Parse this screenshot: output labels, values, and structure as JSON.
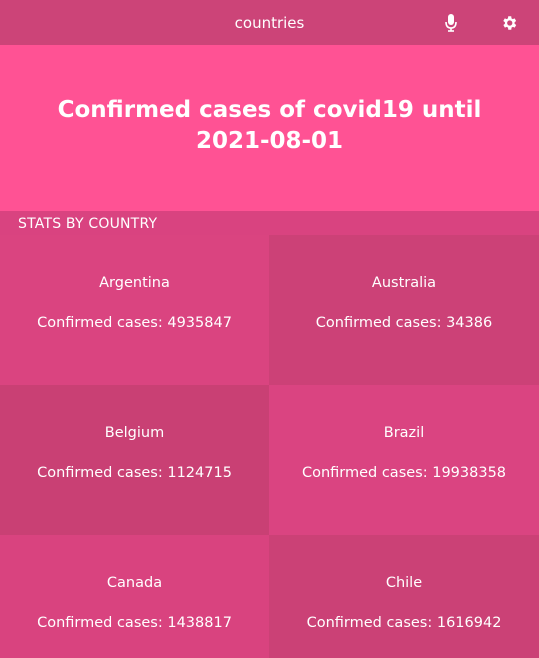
{
  "header": {
    "title": "countries",
    "icons": [
      "microphone-icon",
      "gear-icon"
    ]
  },
  "hero": {
    "title": "Confirmed cases of covid19 until 2021-08-01"
  },
  "section": {
    "label": "STATS BY COUNTRY"
  },
  "countries": [
    {
      "name": "Argentina",
      "cases_text": "Confirmed cases: 4935847"
    },
    {
      "name": "Australia",
      "cases_text": "Confirmed cases: 34386"
    },
    {
      "name": "Belgium",
      "cases_text": "Confirmed cases: 1124715"
    },
    {
      "name": "Brazil",
      "cases_text": "Confirmed cases: 19938358"
    },
    {
      "name": "Canada",
      "cases_text": "Confirmed cases: 1438817"
    },
    {
      "name": "Chile",
      "cases_text": "Confirmed cases: 1616942"
    }
  ],
  "colors": {
    "topbar": "#cc4478",
    "hero": "#ff5294",
    "background": "#d94380"
  }
}
